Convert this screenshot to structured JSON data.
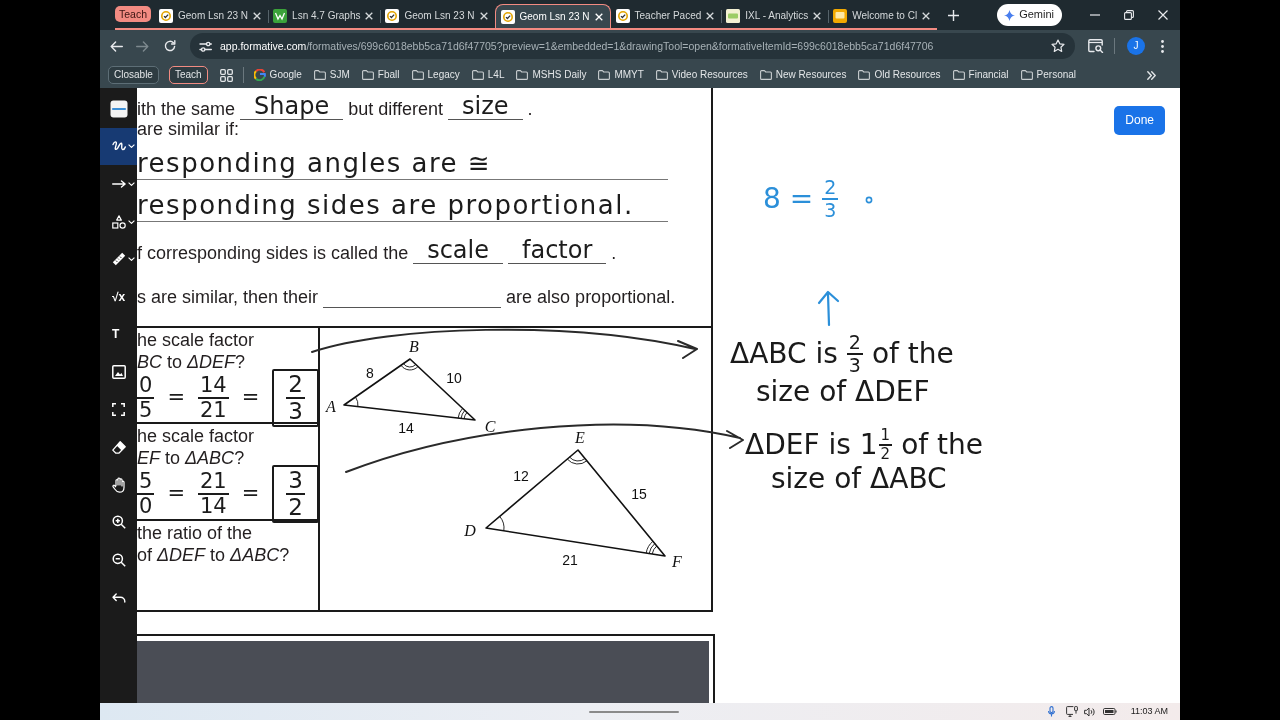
{
  "browser": {
    "tab_group": {
      "label": "Teach",
      "color": "#f28b82"
    },
    "tabs": [
      {
        "title": "Geom Lsn 23 N",
        "kind": "check",
        "selected": false
      },
      {
        "title": "Lsn 4.7 Graphs",
        "kind": "chart",
        "selected": false
      },
      {
        "title": "Geom Lsn 23 N",
        "kind": "check",
        "selected": false
      },
      {
        "title": "Geom Lsn 23 N",
        "kind": "check",
        "selected": true
      },
      {
        "title": "Teacher Paced",
        "kind": "check",
        "selected": false
      },
      {
        "title": "IXL - Analytics",
        "kind": "tile",
        "selected": false
      },
      {
        "title": "Welcome to Cl",
        "kind": "slide",
        "selected": false
      }
    ],
    "assistant": {
      "label": "Gemini"
    },
    "forward": {
      "disabled": true
    },
    "address": {
      "host": "app.formative.com",
      "path": "/formatives/699c6018ebb5ca71d6f47705?preview=1&embedded=1&drawingTool=open&formativeItemId=699c6018ebb5ca71d6f47706"
    },
    "profile": {
      "initial": "J"
    },
    "bookmark_groups": [
      {
        "label": "Closable",
        "color": "#5d6e76"
      },
      {
        "label": "Teach",
        "color": "#f28b82"
      }
    ],
    "bookmarks": [
      {
        "kind": "site",
        "label": "Google"
      },
      {
        "kind": "folder",
        "label": "SJM"
      },
      {
        "kind": "folder",
        "label": "Fball"
      },
      {
        "kind": "folder",
        "label": "Legacy"
      },
      {
        "kind": "folder",
        "label": "L4L"
      },
      {
        "kind": "folder",
        "label": "MSHS Daily"
      },
      {
        "kind": "folder",
        "label": "MMYT"
      },
      {
        "kind": "folder",
        "label": "Video Resources"
      },
      {
        "kind": "folder",
        "label": "New Resources"
      },
      {
        "kind": "folder",
        "label": "Old Resources"
      },
      {
        "kind": "folder",
        "label": "Financial"
      },
      {
        "kind": "folder",
        "label": "Personal"
      }
    ]
  },
  "tools": [
    {
      "kind": "color",
      "selected": false,
      "has_menu": false
    },
    {
      "kind": "pen",
      "selected": true,
      "has_menu": true
    },
    {
      "kind": "line",
      "selected": false,
      "has_menu": true
    },
    {
      "kind": "shapes",
      "selected": false,
      "has_menu": true
    },
    {
      "kind": "ruler",
      "selected": false,
      "has_menu": true
    },
    {
      "kind": "glyph",
      "glyph": "√x",
      "selected": false,
      "has_menu": false
    },
    {
      "kind": "glyph",
      "glyph": "T",
      "selected": false,
      "has_menu": false
    },
    {
      "kind": "image",
      "selected": false,
      "has_menu": false
    },
    {
      "kind": "crop",
      "selected": false,
      "has_menu": false
    },
    {
      "kind": "eraser",
      "selected": false,
      "has_menu": false
    },
    {
      "kind": "hand",
      "selected": false,
      "has_menu": false
    },
    {
      "kind": "zoom_in",
      "selected": false,
      "has_menu": false
    },
    {
      "kind": "zoom_out",
      "selected": false,
      "has_menu": false
    },
    {
      "kind": "undo",
      "selected": false,
      "has_menu": false
    }
  ],
  "worksheet": {
    "lines": [
      [
        {
          "kind": "print",
          "text": "ith the same"
        },
        {
          "kind": "blank",
          "value": "Shape"
        },
        {
          "kind": "print",
          "text": "but different"
        },
        {
          "kind": "blank",
          "value": "size"
        },
        {
          "kind": "print",
          "text": "."
        }
      ],
      [
        {
          "kind": "print",
          "text": "are similar if:"
        }
      ],
      [
        {
          "kind": "answer",
          "value": "responding angles are ≅"
        }
      ],
      [
        {
          "kind": "answer",
          "value": "responding sides are proportional."
        }
      ],
      [
        {
          "kind": "print",
          "text": "f corresponding sides is called the"
        },
        {
          "kind": "blank",
          "value": "scale"
        },
        {
          "kind": "blank",
          "value": "factor"
        },
        {
          "kind": "print",
          "text": "."
        }
      ],
      [
        {
          "kind": "print",
          "text": "s are similar, then their"
        },
        {
          "kind": "blank"
        },
        {
          "kind": "print",
          "text": "are also proportional."
        }
      ]
    ],
    "table": {
      "rows": [
        {
          "lines": [
            "he scale factor",
            "*BC* to *ΔDEF*?"
          ],
          "work": [
            {
              "kind": "frac",
              "num": "0",
              "den": "5"
            },
            {
              "kind": "text",
              "text": "="
            },
            {
              "kind": "frac",
              "num": "14",
              "den": "21"
            },
            {
              "kind": "text",
              "text": "="
            },
            {
              "kind": "boxed",
              "num": "2",
              "den": "3"
            }
          ]
        },
        {
          "lines": [
            "he scale factor",
            "*EF* to *ΔABC*?"
          ],
          "work": [
            {
              "kind": "frac",
              "num": "5",
              "den": "0"
            },
            {
              "kind": "text",
              "text": "="
            },
            {
              "kind": "frac",
              "num": "21",
              "den": "14"
            },
            {
              "kind": "text",
              "text": "="
            },
            {
              "kind": "boxed",
              "num": "3",
              "den": "2"
            }
          ]
        },
        {
          "lines": [
            "the ratio of the",
            "of *ΔDEF* to *ΔABC*?"
          ]
        }
      ]
    },
    "diagram": {
      "triangles": [
        {
          "vertices": [
            "A",
            "B",
            "C"
          ],
          "sides": [
            "8",
            "10",
            "14"
          ]
        },
        {
          "vertices": [
            "D",
            "E",
            "F"
          ],
          "sides": [
            "12",
            "15",
            "21"
          ]
        }
      ]
    }
  },
  "canvas": {
    "done": "Done",
    "notes": [
      {
        "color": "#2b8fd9",
        "lines": [
          [
            {
              "kind": "text",
              "text": "8 ="
            },
            {
              "kind": "frac",
              "num": "2",
              "den": "3"
            }
          ]
        ]
      },
      {
        "color": "#1a1a1a",
        "lines": [
          [
            {
              "kind": "text",
              "text": "ΔABC is"
            },
            {
              "kind": "frac",
              "num": "2",
              "den": "3"
            },
            {
              "kind": "text",
              "text": "of the"
            }
          ],
          [
            {
              "kind": "text",
              "text": "size of ΔDEF"
            }
          ]
        ]
      },
      {
        "color": "#1a1a1a",
        "lines": [
          [
            {
              "kind": "text",
              "text": "ΔDEF is"
            },
            {
              "kind": "mixed",
              "whole": "1",
              "num": "1",
              "den": "2"
            },
            {
              "kind": "text",
              "text": "of the"
            }
          ],
          [
            {
              "kind": "text",
              "text": "size of ΔABC"
            }
          ]
        ]
      }
    ]
  },
  "taskbar": {
    "time": "11:03 AM"
  }
}
